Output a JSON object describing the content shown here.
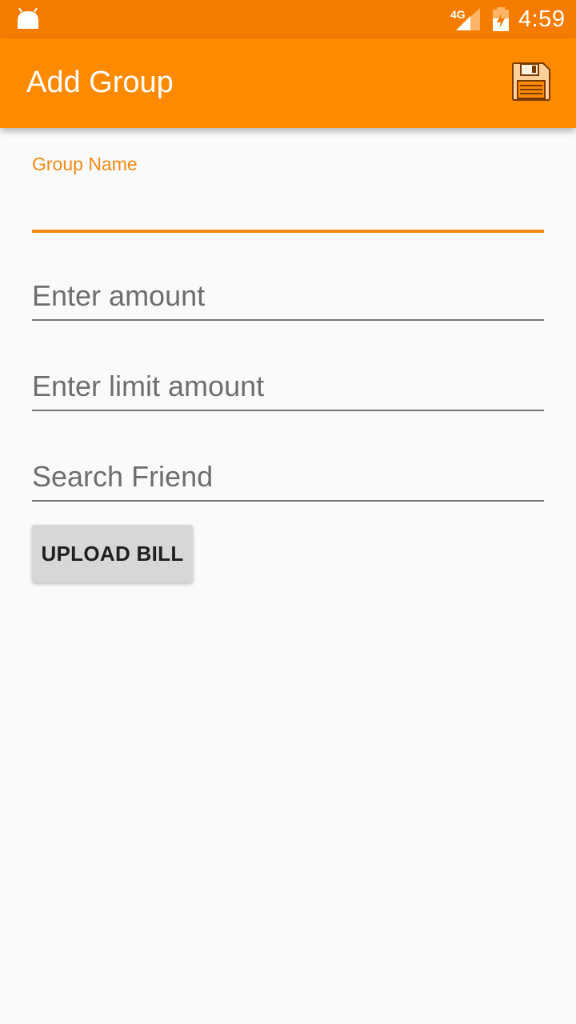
{
  "status_bar": {
    "network": "4G",
    "time": "4:59"
  },
  "app_bar": {
    "title": "Add Group",
    "save_icon": "floppy-disk-icon"
  },
  "form": {
    "group_name": {
      "label": "Group Name",
      "value": ""
    },
    "amount": {
      "placeholder": "Enter amount",
      "value": ""
    },
    "limit_amount": {
      "placeholder": "Enter limit amount",
      "value": ""
    },
    "search_friend": {
      "placeholder": "Search Friend",
      "value": ""
    },
    "upload_bill_label": "UPLOAD BILL"
  },
  "colors": {
    "status_bar": "#f57c00",
    "app_bar": "#ff8a00",
    "accent": "#f28a14",
    "background": "#fafafa"
  }
}
